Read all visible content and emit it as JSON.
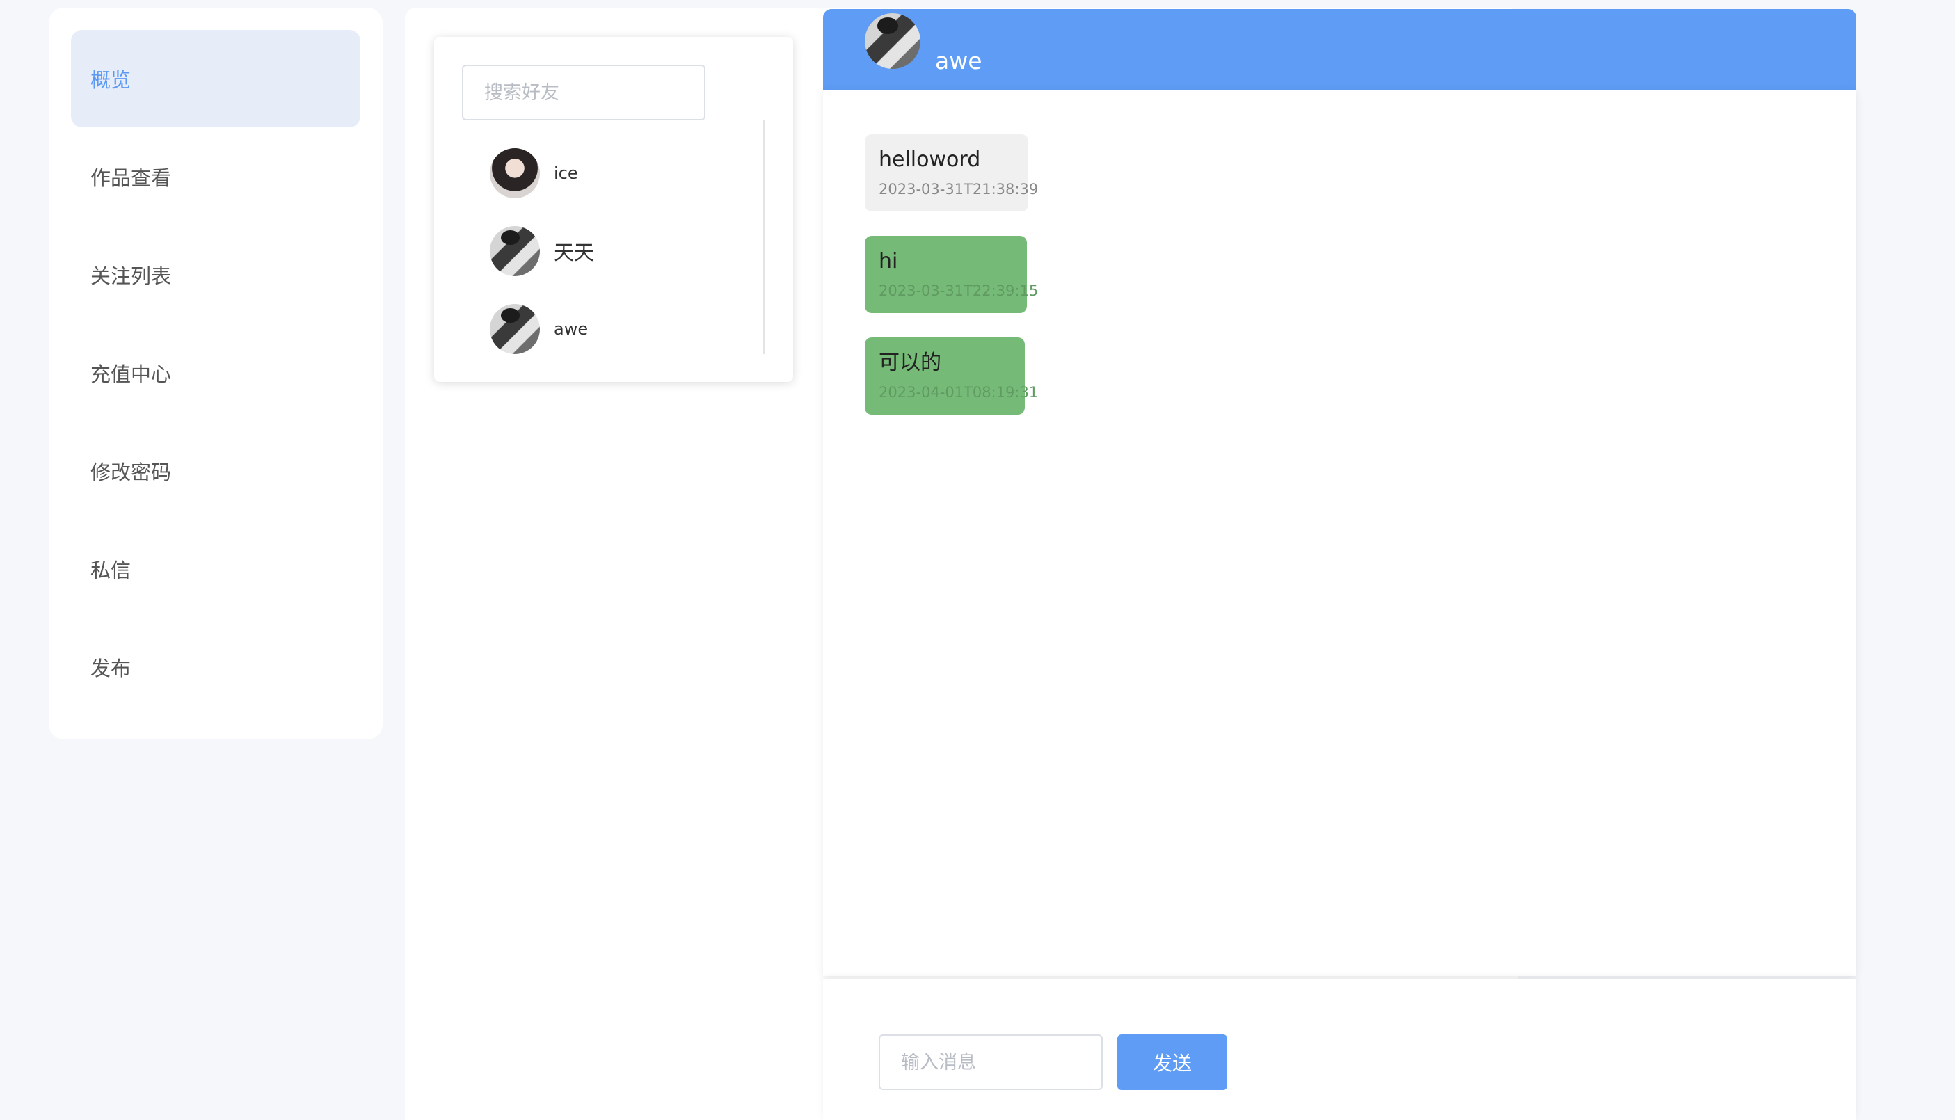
{
  "sidebar": {
    "items": [
      {
        "label": "概览"
      },
      {
        "label": "作品查看"
      },
      {
        "label": "关注列表"
      },
      {
        "label": "充值中心"
      },
      {
        "label": "修改密码"
      },
      {
        "label": "私信"
      },
      {
        "label": "发布"
      }
    ],
    "active_index": 0
  },
  "friends": {
    "search_placeholder": "搜索好友",
    "list": [
      {
        "name": "ice",
        "avatar": "user-avatar-icon"
      },
      {
        "name": "天天",
        "avatar": "user-avatar-icon"
      },
      {
        "name": "awe",
        "avatar": "user-avatar-icon"
      }
    ]
  },
  "chat": {
    "contact_name": "awe",
    "messages": [
      {
        "text": "helloword",
        "time": "2023-03-31T21:38:39",
        "style": "gray"
      },
      {
        "text": "hi",
        "time": "2023-03-31T22:39:15",
        "style": "green"
      },
      {
        "text": "可以的",
        "time": "2023-04-01T08:19:31",
        "style": "green"
      }
    ],
    "input_placeholder": "输入消息",
    "send_label": "发送"
  },
  "colors": {
    "accent": "#5e9cf5",
    "sidebar_active_bg": "#e6edf9",
    "sidebar_active_text": "#5a98f3",
    "bubble_gray": "#f0f0f0",
    "bubble_green": "#76ba78",
    "page_bg": "#f5f7fb"
  }
}
